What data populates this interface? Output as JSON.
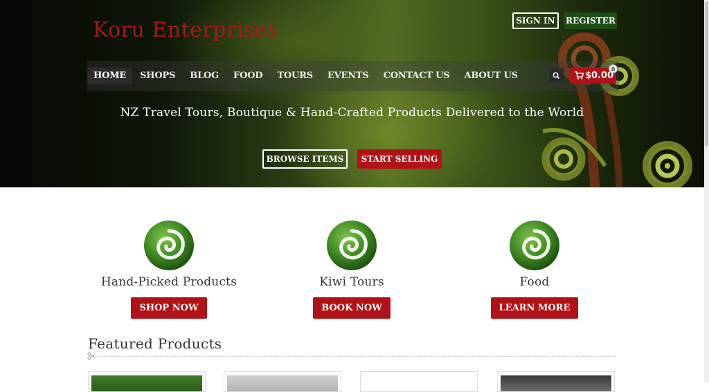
{
  "brand": {
    "name": "Koru Enterprises"
  },
  "auth": {
    "sign_in_label": "SIGN IN",
    "register_label": "REGISTER"
  },
  "nav": {
    "items": [
      {
        "label": "HOME"
      },
      {
        "label": "SHOPS"
      },
      {
        "label": "BLOG"
      },
      {
        "label": "FOOD"
      },
      {
        "label": "TOURS"
      },
      {
        "label": "EVENTS"
      },
      {
        "label": "CONTACT US"
      },
      {
        "label": "ABOUT US"
      }
    ],
    "active_index": 0
  },
  "cart": {
    "total": "$0.00",
    "count": "0",
    "icon": "shopping-cart-icon"
  },
  "search": {
    "icon": "search-icon"
  },
  "hero": {
    "tagline": "NZ Travel Tours, Boutique & Hand-Crafted Products Delivered to the World",
    "browse_label": "BROWSE ITEMS",
    "start_selling_label": "START SELLING"
  },
  "features": [
    {
      "title": "Hand-Picked Products",
      "button": "SHOP NOW",
      "icon": "koru-icon"
    },
    {
      "title": "Kiwi Tours",
      "button": "BOOK NOW",
      "icon": "koru-icon"
    },
    {
      "title": "Food",
      "button": "LEARN MORE",
      "icon": "koru-icon"
    }
  ],
  "featured": {
    "heading": "Featured Products"
  },
  "colors": {
    "brand_red": "#b11218",
    "logo_red": "#a31b1b",
    "register_green": "#1d4d16",
    "koru_green": "#3e8a22"
  }
}
